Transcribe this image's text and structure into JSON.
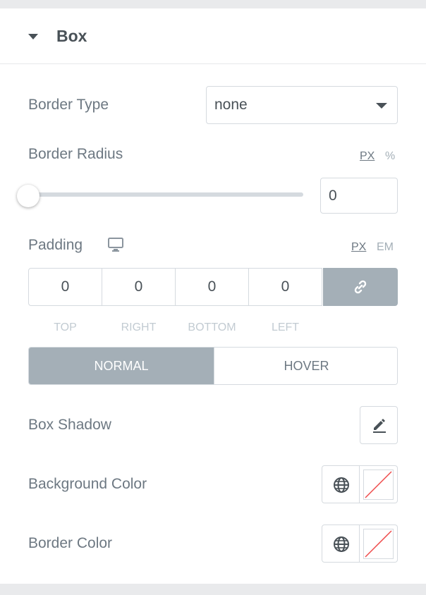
{
  "section": {
    "title": "Box"
  },
  "border_type": {
    "label": "Border Type",
    "value": "none"
  },
  "border_radius": {
    "label": "Border Radius",
    "units": [
      "PX",
      "%"
    ],
    "active_unit": "PX",
    "value": "0",
    "slider_level": 0
  },
  "padding": {
    "label": "Padding",
    "device_icon": "monitor-icon",
    "units": [
      "PX",
      "EM"
    ],
    "active_unit": "PX",
    "values": {
      "top": "0",
      "right": "0",
      "bottom": "0",
      "left": "0"
    },
    "labels": {
      "top": "TOP",
      "right": "RIGHT",
      "bottom": "BOTTOM",
      "left": "LEFT"
    },
    "link_icon": "link-icon"
  },
  "state_tabs": {
    "normal": "NORMAL",
    "hover": "HOVER",
    "active": "NORMAL"
  },
  "box_shadow": {
    "label": "Box Shadow",
    "icon": "pencil-icon"
  },
  "background_color": {
    "label": "Background Color",
    "globe_icon": "globe-icon",
    "swatch": "none"
  },
  "border_color": {
    "label": "Border Color",
    "globe_icon": "globe-icon",
    "swatch": "none"
  },
  "colors": {
    "accent_gray": "#a4afb7",
    "text": "#6d7882",
    "heading": "#495157",
    "empty_swatch_line": "#ef4b4b"
  }
}
